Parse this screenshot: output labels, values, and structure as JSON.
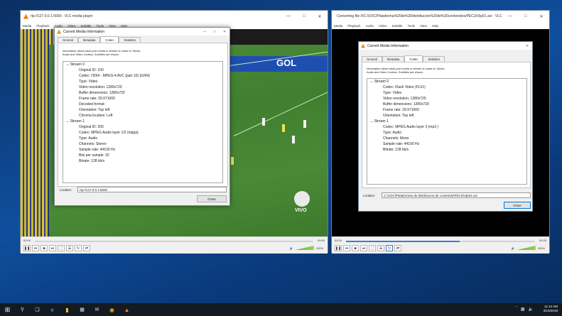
{
  "desktop": {
    "background": "#0f4f9e"
  },
  "left_player": {
    "title": "rtp://127.0.0.1:5000 - VLC media player",
    "menu": [
      "Media",
      "Playback",
      "Audio",
      "Video",
      "Subtitle",
      "Tools",
      "View",
      "Help"
    ],
    "time_elapsed": "00:00",
    "time_total": "00:00",
    "volume": "100%",
    "overlay_text": "VIVO",
    "banner_text": "GOL"
  },
  "right_player": {
    "title": "Converting file:///C:/UOC/Plataforma%20de%20distribucion%20de%20contenidos/PEC2/c5p01.avi - VLC ...",
    "menu": [
      "Media",
      "Playback",
      "Audio",
      "Video",
      "Subtitle",
      "Tools",
      "View",
      "Help"
    ],
    "time_elapsed": "00:15",
    "time_total": "00:25",
    "volume": "100%",
    "progress": 0.6
  },
  "left_dialog": {
    "title": "Current Media Information",
    "tabs": [
      "General",
      "Metadata",
      "Codec",
      "Statistics"
    ],
    "active_tab": "Codec",
    "intro": "Information about what your media or stream is made of. Muxer, Audio and Video Codecs, Subtitles are shown.",
    "tree": [
      {
        "level": 0,
        "text": "Stream 0"
      },
      {
        "level": 1,
        "text": "Original ID: 100"
      },
      {
        "level": 1,
        "text": "Codec: H264 - MPEG-4 AVC (part 10) (h264)"
      },
      {
        "level": 1,
        "text": "Type: Video"
      },
      {
        "level": 1,
        "text": "Video resolution: 1280x720"
      },
      {
        "level": 1,
        "text": "Buffer dimensions: 1280x720"
      },
      {
        "level": 1,
        "text": "Frame rate: 29.971000"
      },
      {
        "level": 1,
        "text": "Decoded format:"
      },
      {
        "level": 1,
        "text": "Orientation: Top left"
      },
      {
        "level": 1,
        "text": "Chroma location: Left"
      },
      {
        "level": 0,
        "text": "Stream 1"
      },
      {
        "level": 1,
        "text": "Original ID: 200"
      },
      {
        "level": 1,
        "text": "Codec: MPEG Audio layer 1/2 (mpga)"
      },
      {
        "level": 1,
        "text": "Type: Audio"
      },
      {
        "level": 1,
        "text": "Channels: Stereo"
      },
      {
        "level": 1,
        "text": "Sample rate: 44100 Hz"
      },
      {
        "level": 1,
        "text": "Bits per sample: 32"
      },
      {
        "level": 1,
        "text": "Bitrate: 128 kb/s"
      }
    ],
    "location_label": "Location:",
    "location_value": "rtp://127.0.0.1:5000",
    "close_label": "Close"
  },
  "right_dialog": {
    "title": "Current Media Information",
    "tabs": [
      "General",
      "Metadata",
      "Codec",
      "Statistics"
    ],
    "active_tab": "Codec",
    "intro": "Information about what your media or stream is made of. Muxer, Audio and Video Codecs, Subtitles are shown.",
    "tree": [
      {
        "level": 0,
        "text": "Stream 0"
      },
      {
        "level": 1,
        "text": "Codec: Flash Video (FLV1)"
      },
      {
        "level": 1,
        "text": "Type: Video"
      },
      {
        "level": 1,
        "text": "Video resolution: 1280x720"
      },
      {
        "level": 1,
        "text": "Buffer dimensions: 1280x720"
      },
      {
        "level": 1,
        "text": "Frame rate: 29.971000"
      },
      {
        "level": 1,
        "text": "Orientation: Top left"
      },
      {
        "level": 0,
        "text": "Stream 1"
      },
      {
        "level": 1,
        "text": "Codec: MPEG Audio layer 3 (mp3 )"
      },
      {
        "level": 1,
        "text": "Type: Audio"
      },
      {
        "level": 1,
        "text": "Channels: Mono"
      },
      {
        "level": 1,
        "text": "Sample rate: 44100 Hz"
      },
      {
        "level": 1,
        "text": "Bitrate: 128 kb/s"
      }
    ],
    "location_label": "Location:",
    "location_value": "C:\\UOC\\Plataformas de distribucion de contenido\\PEC2\\c5p01.avi",
    "close_label": "Close"
  },
  "taskbar": {
    "time": "11:14 AM",
    "date": "4/16/2019",
    "icons": [
      "start-icon",
      "search-icon",
      "task-view-icon",
      "edge-icon",
      "file-explorer-icon",
      "store-icon",
      "mail-icon",
      "chrome-icon",
      "vlc-icon"
    ]
  }
}
